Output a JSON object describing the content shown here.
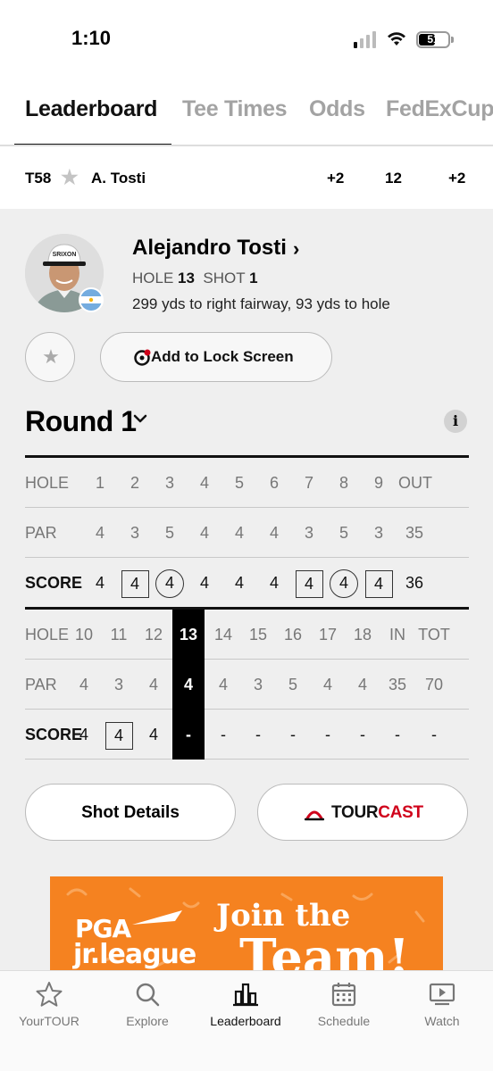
{
  "status": {
    "time": "1:10",
    "battery": "51"
  },
  "tabs": [
    {
      "label": "Leaderboard",
      "active": true
    },
    {
      "label": "Tee Times"
    },
    {
      "label": "Odds"
    },
    {
      "label": "FedExCup"
    }
  ],
  "player_row": {
    "position": "T58",
    "name": "A. Tosti",
    "to_par": "+2",
    "thru": "12",
    "today": "+2"
  },
  "player": {
    "name": "Alejandro Tosti",
    "hole_label": "HOLE",
    "hole": "13",
    "shot_label": "SHOT",
    "shot": "1",
    "shot_desc": "299 yds to right fairway, 93 yds to hole",
    "cap_brand": "SRIXON",
    "flag_country": "Argentina"
  },
  "actions": {
    "lock_screen": "Add to Lock Screen"
  },
  "round": {
    "label": "Round 1",
    "info": "i"
  },
  "scorecard": {
    "front": {
      "hole_label": "HOLE",
      "holes": [
        "1",
        "2",
        "3",
        "4",
        "5",
        "6",
        "7",
        "8",
        "9",
        "OUT"
      ],
      "par_label": "PAR",
      "par": [
        "4",
        "3",
        "5",
        "4",
        "4",
        "4",
        "3",
        "5",
        "3",
        "35"
      ],
      "score_label": "SCORE",
      "score": [
        "4",
        "4",
        "4",
        "4",
        "4",
        "4",
        "4",
        "4",
        "4",
        "36"
      ],
      "score_marks": [
        "",
        "box",
        "circle",
        "",
        "",
        "",
        "box",
        "circle",
        "box",
        ""
      ]
    },
    "back": {
      "hole_label": "HOLE",
      "holes": [
        "10",
        "11",
        "12",
        "13",
        "14",
        "15",
        "16",
        "17",
        "18",
        "IN",
        "TOT"
      ],
      "par_label": "PAR",
      "par": [
        "4",
        "3",
        "4",
        "4",
        "4",
        "3",
        "5",
        "4",
        "4",
        "35",
        "70"
      ],
      "score_label": "SCORE",
      "score": [
        "4",
        "4",
        "4",
        "-",
        "-",
        "-",
        "-",
        "-",
        "-",
        "-",
        "-"
      ],
      "score_marks": [
        "",
        "box",
        "",
        "",
        "",
        "",
        "",
        "",
        "",
        "",
        ""
      ],
      "current_hole_index": 3
    }
  },
  "buttons": {
    "shot_details": "Shot Details",
    "tourcast_a": "TOUR",
    "tourcast_b": "CAST"
  },
  "ad": {
    "line1": "PGA",
    "line2": "jr.league",
    "line3": "Join the",
    "line4": "Team!"
  },
  "nav": [
    {
      "label": "YourTOUR",
      "icon": "star-icon"
    },
    {
      "label": "Explore",
      "icon": "search-icon"
    },
    {
      "label": "Leaderboard",
      "icon": "bar-chart-icon",
      "active": true
    },
    {
      "label": "Schedule",
      "icon": "calendar-icon"
    },
    {
      "label": "Watch",
      "icon": "play-screen-icon"
    }
  ],
  "colors": {
    "accent": "#d0021b",
    "ad_orange": "#f58220",
    "current_hole": "#000000"
  }
}
